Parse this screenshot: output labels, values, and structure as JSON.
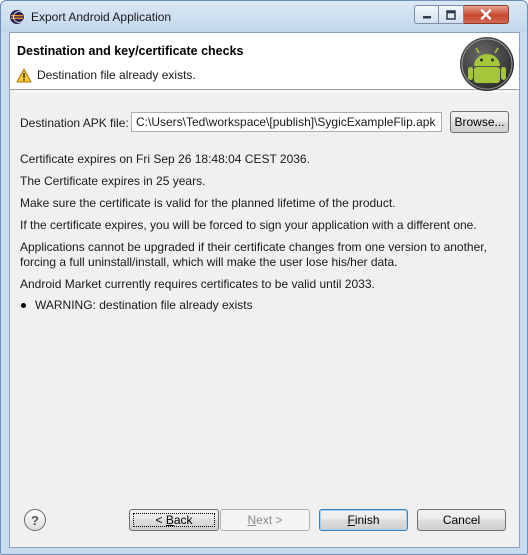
{
  "window": {
    "title": "Export Android Application",
    "controls": {
      "minimize": "minimize",
      "maximize": "maximize",
      "close": "close"
    }
  },
  "header": {
    "title": "Destination and key/certificate checks",
    "message": "Destination file already exists.",
    "message_icon": "warning-icon",
    "logo": "android-logo"
  },
  "destination": {
    "label": "Destination APK file:",
    "value": "C:\\Users\\Ted\\workspace\\[publish]\\SygicExampleFlip.apk",
    "browse_label": "Browse..."
  },
  "messages": [
    "Certificate expires on Fri Sep 26 18:48:04 CEST 2036.",
    "The Certificate expires in 25 years.",
    "Make sure the certificate is valid for the planned lifetime of the product.",
    "If the certificate expires, you will be forced to sign your application with a different one.",
    "Applications cannot be upgraded if their certificate changes from one version to another,",
    "forcing a full uninstall/install, which will make the user lose his/her data.",
    "Android Market currently requires certificates to be valid until 2033."
  ],
  "bullets": [
    "WARNING: destination file already exists"
  ],
  "footer": {
    "help_icon": "help-icon",
    "help_glyph": "?",
    "back_mnemonic": "B",
    "back_rest": "ack",
    "back_prefix": "< ",
    "next_mnemonic": "N",
    "next_rest": "ext >",
    "finish_mnemonic": "F",
    "finish_rest": "inish",
    "cancel_label": "Cancel",
    "next_enabled": false
  },
  "colors": {
    "frame": "#c9dcef",
    "dialog_bg": "#f0f0f0",
    "default_button_border": "#3c7fb1",
    "android_green": "#a4c639"
  }
}
